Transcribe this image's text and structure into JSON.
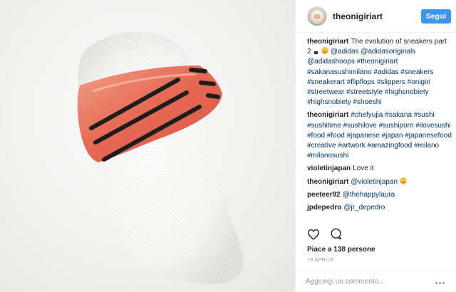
{
  "post": {
    "author": "theonigiriart",
    "follow_label": "Segui",
    "caption": {
      "user": "theonigiriart",
      "segments": [
        {
          "text": "The evolution of sneakers part 2 ",
          "tag": false
        },
        {
          "text": "@adidas @adidasoriginals @adidashoops #theonigiriart #sakanasushimilano #adidas #sneakers #sneakerart #flipflops #slippers #onigiri #streetwear #streetstyle #highsnobiety #highsnobiety #shoeshi",
          "tag": true
        }
      ],
      "emojis": [
        "onigiri-emoji",
        "smile-emoji"
      ]
    },
    "comments": [
      {
        "user": "theonigiriart",
        "text": "#chefyujia #sakana #sushi #sushitime #sushilove #sushiporn #ilovesushi #food #food #japanese #japan #japanesefood #creative #artwork #amazingfood #milano #milanosushi",
        "tag": true
      },
      {
        "user": "violetinjapan",
        "text": "Love it",
        "tag": false
      },
      {
        "user": "theonigiriart",
        "text": "@violetinjapan",
        "tag": true,
        "emoji": "smile-emoji"
      },
      {
        "user": "peeteer92",
        "text": "@thehappylaura",
        "tag": true
      },
      {
        "user": "jpdepedro",
        "text": "@jr_depedro",
        "tag": true
      }
    ],
    "likes": "Piace a 138 persone",
    "date": "19 APRILE",
    "add_comment_placeholder": "Aggiungi un commento...",
    "icons": [
      "heart-icon",
      "comment-icon",
      "more-options-icon"
    ],
    "colors": {
      "accent": "#3897f0",
      "link": "#003569",
      "muted": "#999999"
    }
  }
}
